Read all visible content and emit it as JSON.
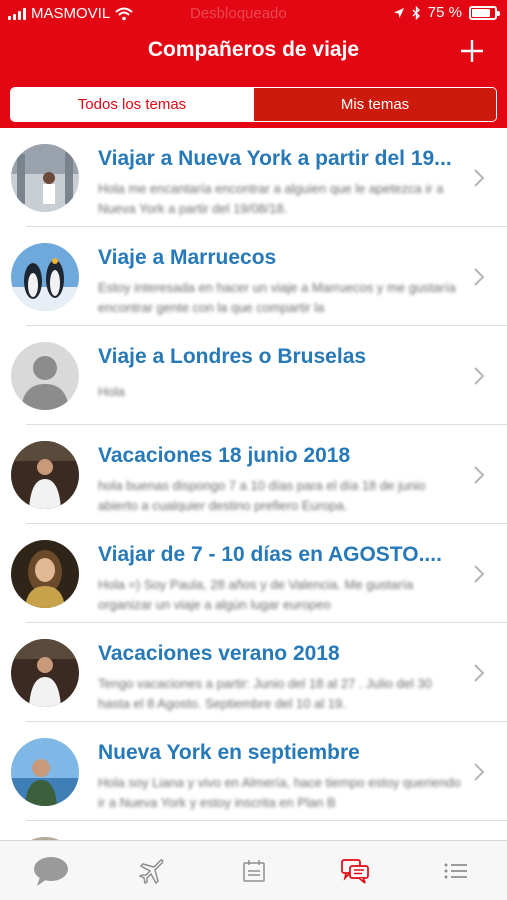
{
  "status": {
    "carrier": "MASMOVIL",
    "center_text": "Desbloqueado",
    "battery": "75 %"
  },
  "header": {
    "title": "Compañeros de viaje"
  },
  "segments": {
    "all_topics": "Todos los temas",
    "my_topics": "Mis temas"
  },
  "topics": [
    {
      "title": "Viajar a Nueva York a partir del 19...",
      "preview": "Hola me encantaría encontrar a alguien que le apetezca ir a Nueva York a partir del 19/08/18."
    },
    {
      "title": "Viaje a Marruecos",
      "preview": "Estoy interesada en hacer un viaje a Marruecos y me gustaría encontrar gente con la que compartir la"
    },
    {
      "title": "Viaje a Londres o Bruselas",
      "preview": "Hola"
    },
    {
      "title": "Vacaciones 18  junio  2018",
      "preview": "hola buenas dispongo 7 a 10 días para el día 18 de junio abierto a cualquier destino prefiero Europa."
    },
    {
      "title": "Viajar de 7 - 10 días en AGOSTO....",
      "preview": "Hola =) Soy Paula, 28 años y de Valencia. Me gustaría organizar un viaje a algún lugar europeo"
    },
    {
      "title": "Vacaciones verano 2018",
      "preview": "Tengo vacaciones a partir: Junio del 18 al 27 . Julio del 30 hasta el 8 Agosto. Septiembre del 10 al 19."
    },
    {
      "title": "Nueva York en septiembre",
      "preview": "Hola soy Liana y vivo en Almería, hace tiempo estoy queriendo ir a Nueva York y estoy inscrita en Plan B"
    }
  ],
  "colors": {
    "brand_red": "#e30613",
    "title_blue": "#2779b8"
  },
  "tabbar": {
    "active_tab": "messages",
    "icons": [
      "chat-bubble-icon",
      "airplane-icon",
      "calendar-icon",
      "messages-icon",
      "list-icon"
    ]
  }
}
